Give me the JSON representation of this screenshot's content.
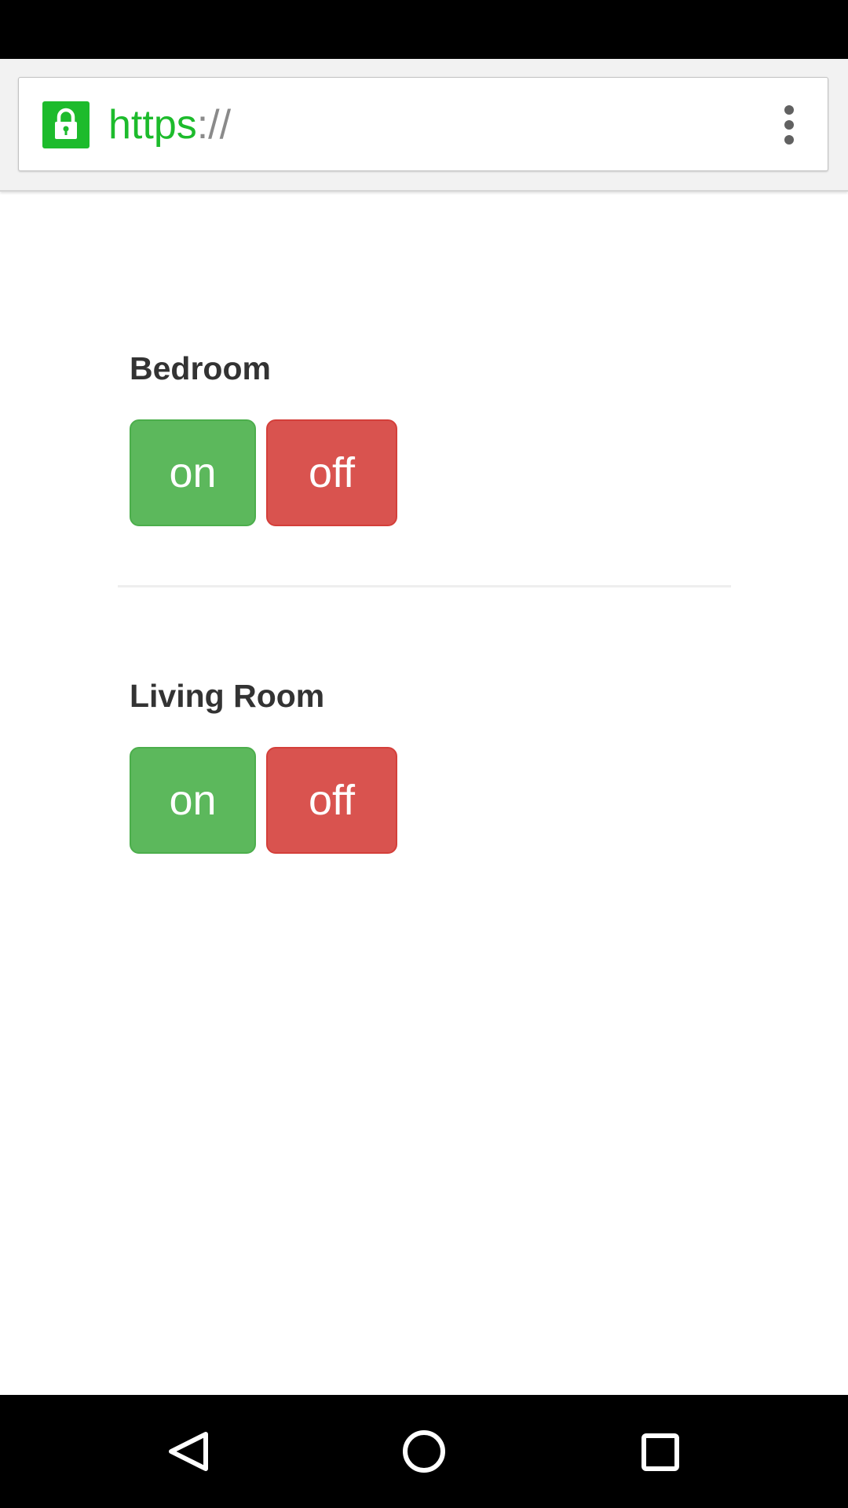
{
  "browser": {
    "url_scheme": "https",
    "url_separator": "://",
    "lock_icon": "lock-icon",
    "menu_icon": "vertical-dots-icon",
    "accent_color": "#1dbb2c"
  },
  "rooms": [
    {
      "title": "Bedroom",
      "on_label": "on",
      "off_label": "off"
    },
    {
      "title": "Living Room",
      "on_label": "on",
      "off_label": "off"
    }
  ],
  "colors": {
    "on_button": "#5cb85c",
    "off_button": "#d9534f",
    "heading_text": "#333333"
  },
  "nav": {
    "back_icon": "back-triangle-icon",
    "home_icon": "home-circle-icon",
    "recents_icon": "recents-square-icon"
  }
}
